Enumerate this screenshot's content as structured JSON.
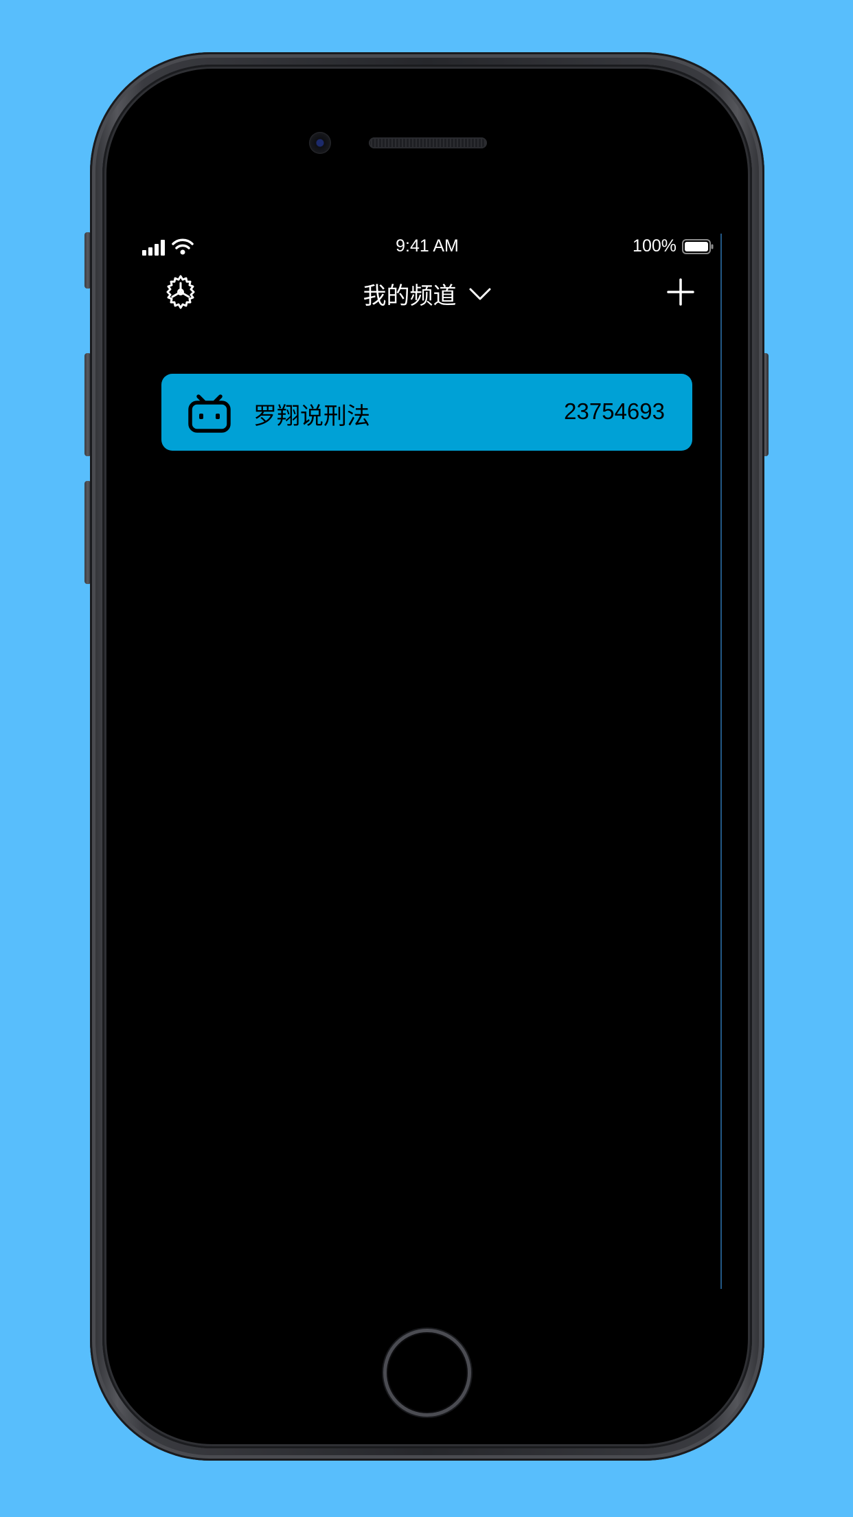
{
  "status_bar": {
    "time": "9:41 AM",
    "battery": "100%",
    "signal_icon": "cellular-signal-icon",
    "wifi_icon": "wifi-icon",
    "battery_icon": "battery-full-icon"
  },
  "nav": {
    "title": "我的频道",
    "left_icon": "settings-gear-icon",
    "title_icon": "chevron-down-icon",
    "right_icon": "plus-icon"
  },
  "channels": [
    {
      "icon": "bilibili-tv-icon",
      "name": "罗翔说刑法",
      "id": "23754693"
    }
  ],
  "colors": {
    "background": "#58befc",
    "screen": "#000000",
    "card": "#00a1d6",
    "text_light": "#ffffff",
    "text_dark": "#000000"
  }
}
